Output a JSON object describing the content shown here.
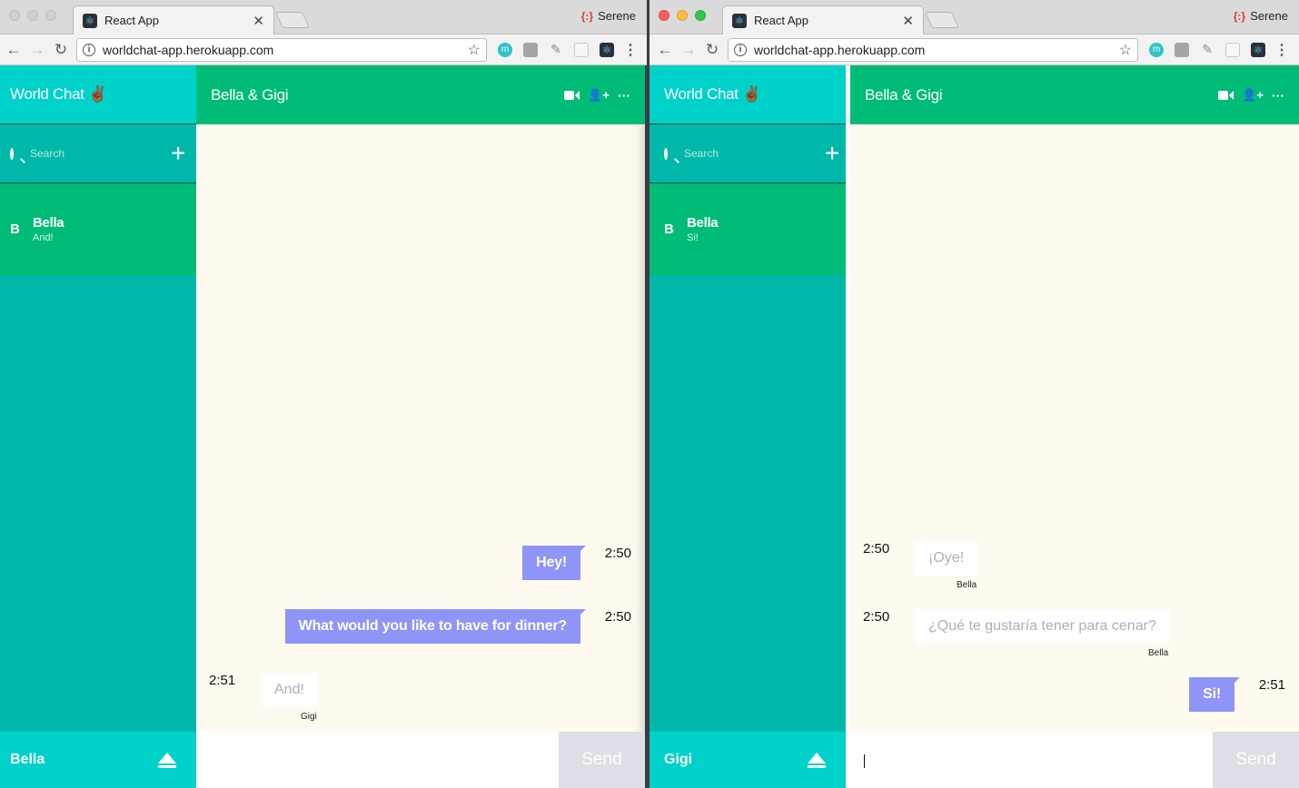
{
  "windows": {
    "left": {
      "browser": {
        "tab_title": "React App",
        "tab_favicon": "react-icon",
        "profile_name": "Serene",
        "url": "worldchat-app.herokuapp.com"
      },
      "app": {
        "app_title": "World Chat ✌🏾",
        "search_placeholder": "Search",
        "conversation": {
          "initial": "B",
          "name": "Bella",
          "last_message": "And!"
        },
        "chat_title": "Bella & Gigi",
        "messages": [
          {
            "direction": "out",
            "text": "Hey!",
            "time": "2:50"
          },
          {
            "direction": "out",
            "text": "What would you like to have for dinner?",
            "time": "2:50"
          },
          {
            "direction": "in",
            "text": "And!",
            "time": "2:51",
            "sender": "Gigi"
          }
        ],
        "current_user": "Bella",
        "composer_value": "",
        "send_label": "Send"
      }
    },
    "right": {
      "browser": {
        "tab_title": "React App",
        "tab_favicon": "react-icon",
        "profile_name": "Serene",
        "url": "worldchat-app.herokuapp.com"
      },
      "app": {
        "app_title": "World Chat ✌🏾",
        "search_placeholder": "Search",
        "conversation": {
          "initial": "B",
          "name": "Bella",
          "last_message": "Si!"
        },
        "chat_title": "Bella & Gigi",
        "messages": [
          {
            "direction": "in",
            "text": "¡Oye!",
            "time": "2:50",
            "sender": "Bella"
          },
          {
            "direction": "in",
            "text": "¿Qué te gustaría tener para cenar?",
            "time": "2:50",
            "sender": "Bella"
          },
          {
            "direction": "out",
            "text": "Si!",
            "time": "2:51"
          }
        ],
        "current_user": "Gigi",
        "composer_value": "",
        "send_label": "Send"
      }
    }
  },
  "colors": {
    "sidebar_header": "#00d2c9",
    "sidebar_body": "#00b8a9",
    "active_conversation": "#00bc76",
    "chat_background": "#fffaef",
    "outgoing_bubble": "#8f95f7",
    "send_button": "#dedee6"
  }
}
